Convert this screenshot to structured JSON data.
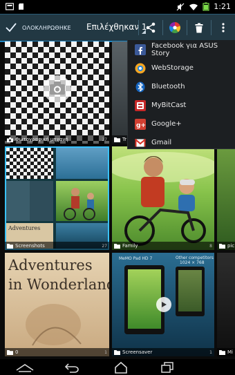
{
  "status_bar": {
    "time": "1:21",
    "icons": [
      "notification-icon",
      "sd-card-icon",
      "mute-icon",
      "wifi-icon",
      "battery-icon"
    ]
  },
  "action_bar": {
    "done_label": "ΟΛΟΚΛΗΡΩΘΗΚΕ",
    "title": "Επιλέχθηκαν 1",
    "icons": [
      "share-icon",
      "picasa-icon",
      "delete-icon",
      "overflow-icon"
    ]
  },
  "tiles": [
    {
      "label": "Φωτογραφική μηχανή",
      "count": "27"
    },
    {
      "label": "Tr",
      "count": ""
    },
    {
      "label": "Screenshots",
      "count": "27"
    },
    {
      "label": "Family",
      "count": "8"
    },
    {
      "label": "pic",
      "count": ""
    },
    {
      "label": "0",
      "count": "1"
    },
    {
      "label": "Screensaver",
      "count": "1"
    },
    {
      "label": "Mi",
      "count": ""
    }
  ],
  "adventures": {
    "line1": "Adventures",
    "line2": "in Wonderland"
  },
  "screensaver_card": {
    "product": "MeMO Pad HD 7",
    "compare": "Other competitors",
    "res": "1024 × 768"
  },
  "share_menu": [
    {
      "label": "Facebook για ASUS Story",
      "icon": "facebook-asus-icon"
    },
    {
      "label": "WebStorage",
      "icon": "webstorage-icon"
    },
    {
      "label": "Bluetooth",
      "icon": "bluetooth-icon"
    },
    {
      "label": "MyBitCast",
      "icon": "mybitcast-icon"
    },
    {
      "label": "Google+",
      "icon": "google-plus-icon"
    },
    {
      "label": "Gmail",
      "icon": "gmail-icon"
    }
  ],
  "nav_bar": {
    "icons": [
      "collapse-icon",
      "back-icon",
      "home-icon",
      "recent-apps-icon"
    ]
  },
  "colors": {
    "accent": "#1f86c4",
    "selection": "#39c2ff",
    "menu_bg": "#1c1f22"
  }
}
